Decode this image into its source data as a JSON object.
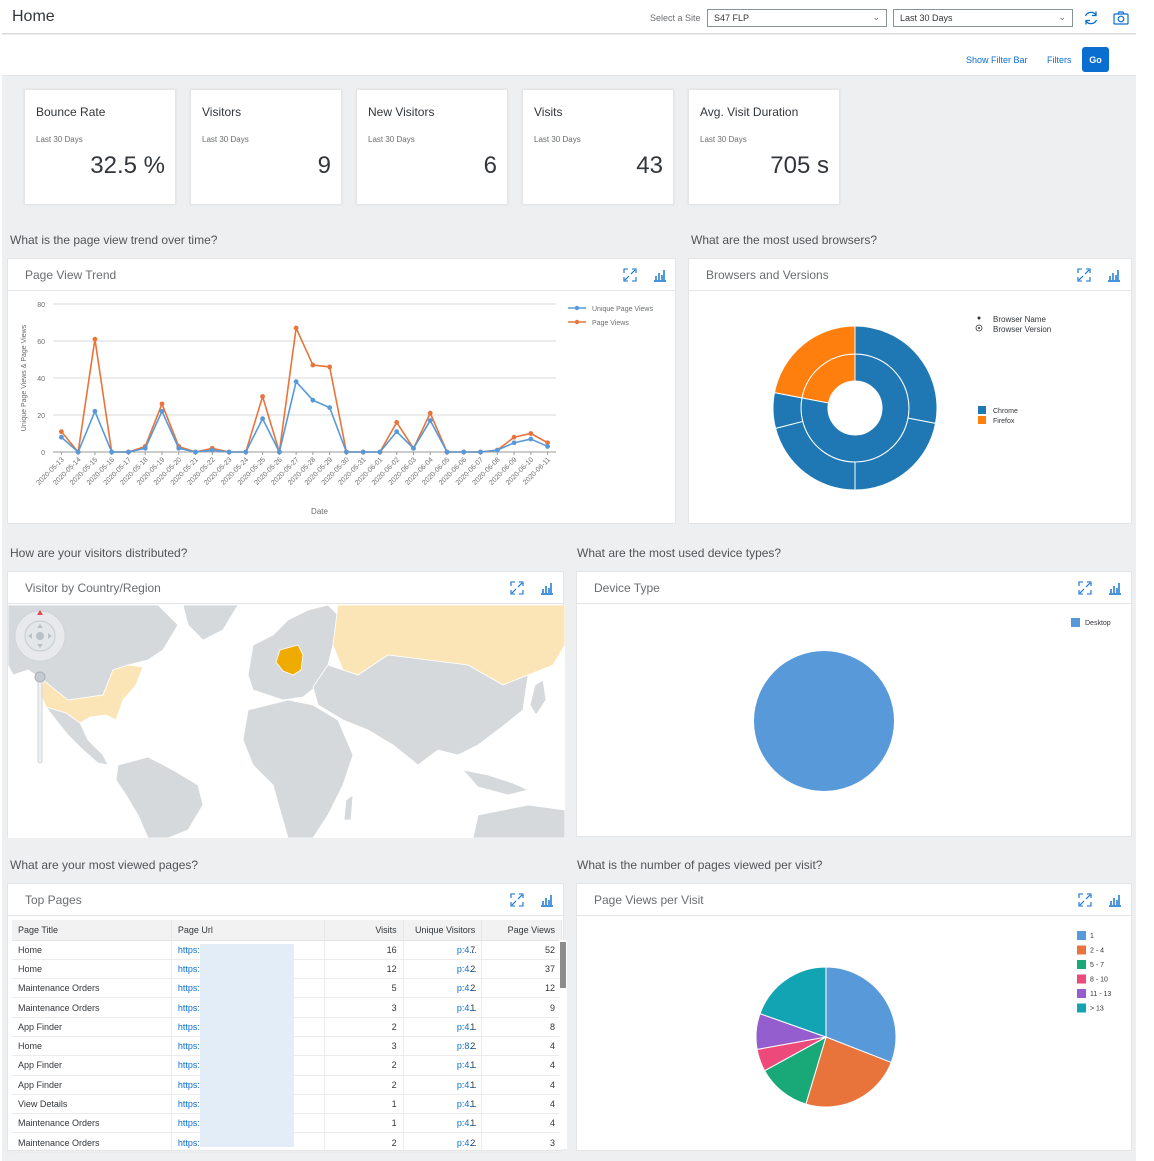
{
  "header": {
    "title": "Home",
    "site_label": "Select a Site",
    "site_value": "S47 FLP",
    "range_value": "Last 30 Days",
    "refresh_icon": "refresh-icon",
    "camera_icon": "camera-icon"
  },
  "filterbar": {
    "show_filter_bar": "Show Filter Bar",
    "filters": "Filters",
    "go": "Go"
  },
  "kpis": [
    {
      "title": "Bounce Rate",
      "subtitle": "Last 30 Days",
      "value": "32.5 %"
    },
    {
      "title": "Visitors",
      "subtitle": "Last 30 Days",
      "value": "9"
    },
    {
      "title": "New Visitors",
      "subtitle": "Last 30 Days",
      "value": "6"
    },
    {
      "title": "Visits",
      "subtitle": "Last 30 Days",
      "value": "43"
    },
    {
      "title": "Avg. Visit Duration",
      "subtitle": "Last 30 Days",
      "value": "705 s"
    }
  ],
  "questions": {
    "trend": "What is the page view trend over time?",
    "browsers": "What are the most used browsers?",
    "visitors": "How are your visitors distributed?",
    "devices": "What are the most used device types?",
    "pages": "What are your most viewed pages?",
    "per_visit": "What is the number of pages viewed per visit?"
  },
  "cards": {
    "trend": "Page View Trend",
    "browsers": "Browsers and Versions",
    "map": "Visitor by Country/Region",
    "devices": "Device Type",
    "pages": "Top Pages",
    "per_visit": "Page Views per Visit"
  },
  "colors": {
    "accent": "#0a6ed1",
    "unique": "#5899da",
    "pageviews": "#e8743b",
    "chrome": "#1f77b4",
    "firefox": "#ff7f0e",
    "map_highlight": "#f0ab00",
    "map_visited": "#fbe5b6",
    "map_land": "#d5d9dc"
  },
  "map": {
    "highlighted_country": "Germany",
    "visited_countries": [
      "United States",
      "Russia"
    ]
  },
  "top_pages": {
    "columns": [
      "Page Title",
      "Page Url",
      "Visits",
      "Unique Visitors",
      "Page Views"
    ],
    "rows": [
      {
        "title": "Home",
        "url_start": "https:/",
        "url_end": "p:4...",
        "visits": "16",
        "unique": "7",
        "views": "52"
      },
      {
        "title": "Home",
        "url_start": "https:/",
        "url_end": "p:4...",
        "visits": "12",
        "unique": "2",
        "views": "37"
      },
      {
        "title": "Maintenance Orders",
        "url_start": "https:/",
        "url_end": "p:4...",
        "visits": "5",
        "unique": "2",
        "views": "12"
      },
      {
        "title": "Maintenance Orders",
        "url_start": "https:/",
        "url_end": "p:4...",
        "visits": "3",
        "unique": "1",
        "views": "9"
      },
      {
        "title": "App Finder",
        "url_start": "https:/",
        "url_end": "p:4...",
        "visits": "2",
        "unique": "1",
        "views": "8"
      },
      {
        "title": "Home",
        "url_start": "https:/",
        "url_end": "p:8...",
        "visits": "3",
        "unique": "2",
        "views": "4"
      },
      {
        "title": "App Finder",
        "url_start": "https:/",
        "url_end": "p:4...",
        "visits": "2",
        "unique": "1",
        "views": "4"
      },
      {
        "title": "App Finder",
        "url_start": "https:/",
        "url_end": "p:4...",
        "visits": "2",
        "unique": "1",
        "views": "4"
      },
      {
        "title": "View Details",
        "url_start": "https:/",
        "url_end": "p:4...",
        "visits": "1",
        "unique": "1",
        "views": "4"
      },
      {
        "title": "Maintenance Orders",
        "url_start": "https:/",
        "url_end": "p:4...",
        "visits": "1",
        "unique": "1",
        "views": "4"
      },
      {
        "title": "Maintenance Orders",
        "url_start": "https:/",
        "url_end": "p:4...",
        "visits": "2",
        "unique": "2",
        "views": "3"
      }
    ]
  },
  "chart_data": [
    {
      "type": "line",
      "title": "Page View Trend",
      "xlabel": "Date",
      "ylabel": "Unique Page Views & Page Views",
      "ylim": [
        0,
        80
      ],
      "yticks": [
        0,
        20,
        40,
        60,
        80
      ],
      "grid": true,
      "legend": "top-right",
      "x": [
        "2020-05-13",
        "2020-05-14",
        "2020-05-15",
        "2020-05-16",
        "2020-05-17",
        "2020-05-18",
        "2020-05-19",
        "2020-05-20",
        "2020-05-21",
        "2020-05-22",
        "2020-05-23",
        "2020-05-24",
        "2020-05-25",
        "2020-05-26",
        "2020-05-27",
        "2020-05-28",
        "2020-05-29",
        "2020-05-30",
        "2020-05-31",
        "2020-06-01",
        "2020-06-02",
        "2020-06-03",
        "2020-06-04",
        "2020-06-05",
        "2020-06-06",
        "2020-06-07",
        "2020-06-08",
        "2020-06-09",
        "2020-06-10",
        "2020-06-11"
      ],
      "series": [
        {
          "name": "Unique Page Views",
          "values": [
            8,
            0,
            22,
            0,
            0,
            2,
            22,
            2,
            0,
            1,
            0,
            0,
            18,
            0,
            38,
            28,
            24,
            0,
            0,
            0,
            11,
            2,
            17,
            0,
            0,
            0,
            1,
            5,
            7,
            3
          ]
        },
        {
          "name": "Page Views",
          "values": [
            11,
            0,
            61,
            0,
            0,
            3,
            26,
            3,
            0,
            2,
            0,
            0,
            30,
            0,
            67,
            47,
            46,
            0,
            0,
            0,
            16,
            2,
            21,
            0,
            0,
            0,
            1,
            8,
            10,
            5
          ]
        }
      ]
    },
    {
      "type": "pie",
      "subtype": "sunburst",
      "title": "Browsers and Versions",
      "legend": "right",
      "legend_levels": [
        "Browser Name",
        "Browser Version"
      ],
      "categories": [
        "Chrome",
        "Firefox"
      ],
      "inner_ring": [
        {
          "name": "Chrome",
          "value": 78
        },
        {
          "name": "Firefox",
          "value": 22
        }
      ],
      "outer_ring": [
        {
          "name": "Chrome",
          "value": 28
        },
        {
          "name": "Chrome",
          "value": 22
        },
        {
          "name": "Chrome",
          "value": 21
        },
        {
          "name": "Chrome",
          "value": 7
        },
        {
          "name": "Firefox",
          "value": 22
        }
      ]
    },
    {
      "type": "pie",
      "title": "Device Type",
      "legend": "top-right",
      "categories": [
        "Desktop"
      ],
      "values": [
        100
      ]
    },
    {
      "type": "pie",
      "title": "Page Views per Visit",
      "legend": "top-right",
      "categories": [
        "1",
        "2 - 4",
        "5 - 7",
        "8 - 10",
        "11 - 13",
        "> 13"
      ],
      "values": [
        30,
        23,
        12,
        5,
        8,
        19
      ]
    }
  ]
}
